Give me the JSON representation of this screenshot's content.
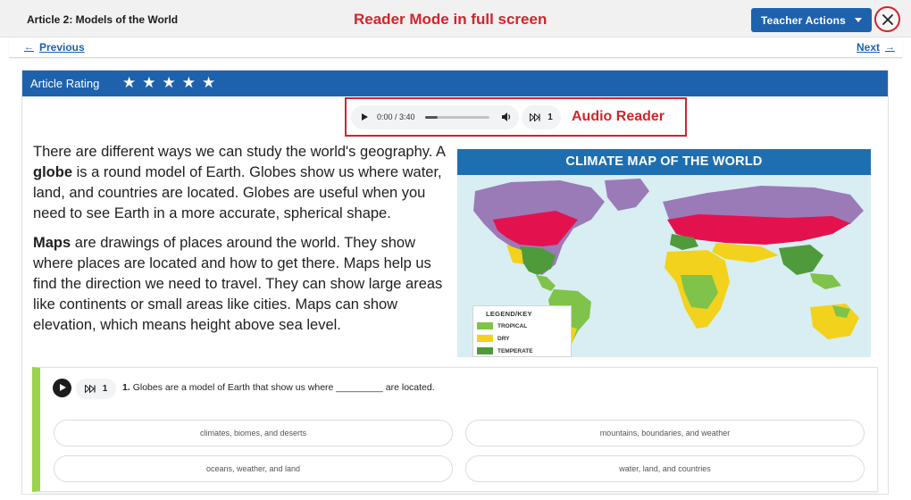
{
  "header": {
    "article_title": "Article 2: Models of the World",
    "annotation": "Reader Mode in full screen",
    "teacher_actions_label": "Teacher Actions"
  },
  "nav": {
    "previous_label": "Previous",
    "next_label": "Next"
  },
  "rating": {
    "label": "Article Rating",
    "stars": 5
  },
  "audio": {
    "time": "0:00 / 3:40",
    "progress_fraction": 0.2,
    "speed": "1",
    "annotation": "Audio Reader"
  },
  "article": {
    "p1": {
      "before": "There are different ways we can study the world's geography. A ",
      "bold": "globe",
      "after": " is a round model of Earth. Globes show us where water, land, and countries are located. Globes are useful when you need to see Earth in a more accurate, spherical shape."
    },
    "p2": {
      "bold": "Maps",
      "after": " are drawings of places around the world. They show where places are located and how to get there. Maps help us find the direction we need to travel. They can show large areas like continents or small areas like cities. Maps can show elevation, which means height above sea level."
    }
  },
  "map": {
    "title": "CLIMATE MAP OF THE WORLD",
    "legend_title": "LEGEND/KEY",
    "legend": [
      {
        "label": "TROPICAL",
        "color": "#7fc34a"
      },
      {
        "label": "DRY",
        "color": "#f2d21c"
      },
      {
        "label": "TEMPERATE",
        "color": "#4f9a3a"
      }
    ],
    "colors": {
      "ocean": "#d8eef2",
      "polar": "#9b7ab8",
      "continental": "#e3124f",
      "dry": "#f2d21c",
      "tropical": "#7fc34a",
      "temperate": "#4f9a3a"
    }
  },
  "question": {
    "speed": "1",
    "number": "1.",
    "text": "Globes are a model of Earth that show us where _________ are located.",
    "options": [
      "climates, biomes, and deserts",
      "mountains, boundaries, and weather",
      "oceans, weather, and land",
      "water, land, and countries"
    ]
  },
  "colors": {
    "brand_blue": "#1e62ae",
    "annotation_red": "#d0262b",
    "question_accent": "#9ad34a"
  }
}
